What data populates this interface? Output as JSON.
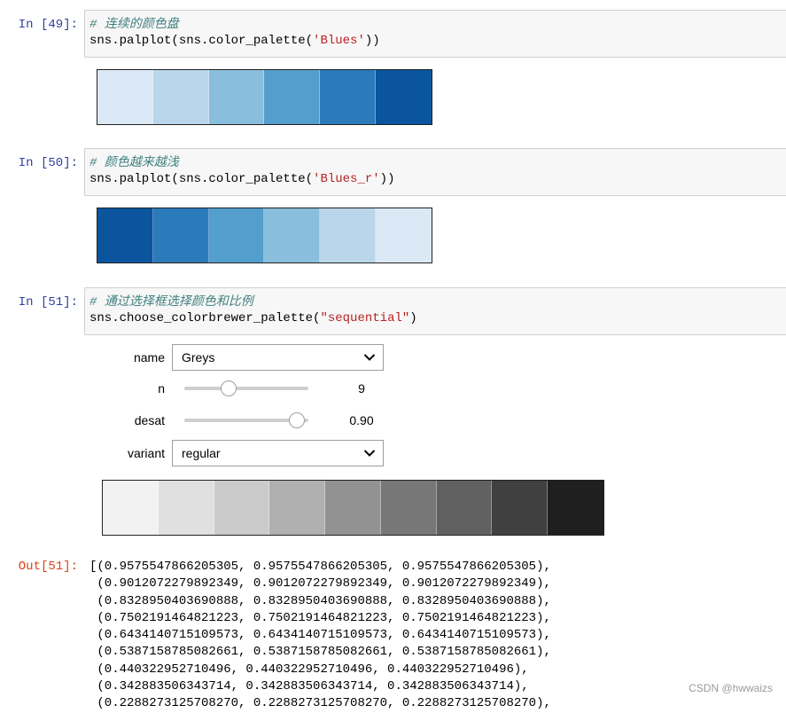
{
  "cells": [
    {
      "prompt": "In [49]:",
      "comment": "# 连续的颜色盘",
      "code_prefix": "sns.palplot(sns.color_palette(",
      "code_string": "'Blues'",
      "code_suffix": "))",
      "palette": [
        "#dbe9f6",
        "#bad6eb",
        "#89bedc",
        "#539ecd",
        "#2b7bba",
        "#0b559f"
      ]
    },
    {
      "prompt": "In [50]:",
      "comment": "# 颜色越来越浅",
      "code_prefix": "sns.palplot(sns.color_palette(",
      "code_string": "'Blues_r'",
      "code_suffix": "))",
      "palette": [
        "#0b559f",
        "#2b7bba",
        "#539ecd",
        "#89bedc",
        "#bad6eb",
        "#dbe9f6"
      ]
    },
    {
      "prompt": "In [51]:",
      "comment": "# 通过选择框选择颜色和比例",
      "code_prefix": "sns.choose_colorbrewer_palette(",
      "code_string": "\"sequential\"",
      "code_suffix": ")"
    }
  ],
  "widgets": {
    "name": {
      "label": "name",
      "value": "Greys"
    },
    "n": {
      "label": "n",
      "value": "9",
      "fraction": 0.35
    },
    "desat": {
      "label": "desat",
      "value": "0.90",
      "fraction": 0.9
    },
    "variant": {
      "label": "variant",
      "value": "regular"
    }
  },
  "greys_palette": [
    "#f2f2f2",
    "#e0e0e0",
    "#cbcbcb",
    "#b0b0b0",
    "#929292",
    "#777777",
    "#606060",
    "#404040",
    "#1f1f1f"
  ],
  "output": {
    "prompt": "Out[51]:",
    "lines": [
      "[(0.9575547866205305, 0.9575547866205305, 0.9575547866205305),",
      " (0.9012072279892349, 0.9012072279892349, 0.9012072279892349),",
      " (0.8328950403690888, 0.8328950403690888, 0.8328950403690888),",
      " (0.7502191464821223, 0.7502191464821223, 0.7502191464821223),",
      " (0.6434140715109573, 0.6434140715109573, 0.6434140715109573),",
      " (0.5387158785082661, 0.5387158785082661, 0.5387158785082661),",
      " (0.440322952710496, 0.440322952710496, 0.440322952710496),",
      " (0.342883506343714, 0.342883506343714, 0.342883506343714),",
      " (0.2288273125708270, 0.2288273125708270, 0.2288273125708270),"
    ]
  },
  "watermark": "CSDN @hwwaizs"
}
